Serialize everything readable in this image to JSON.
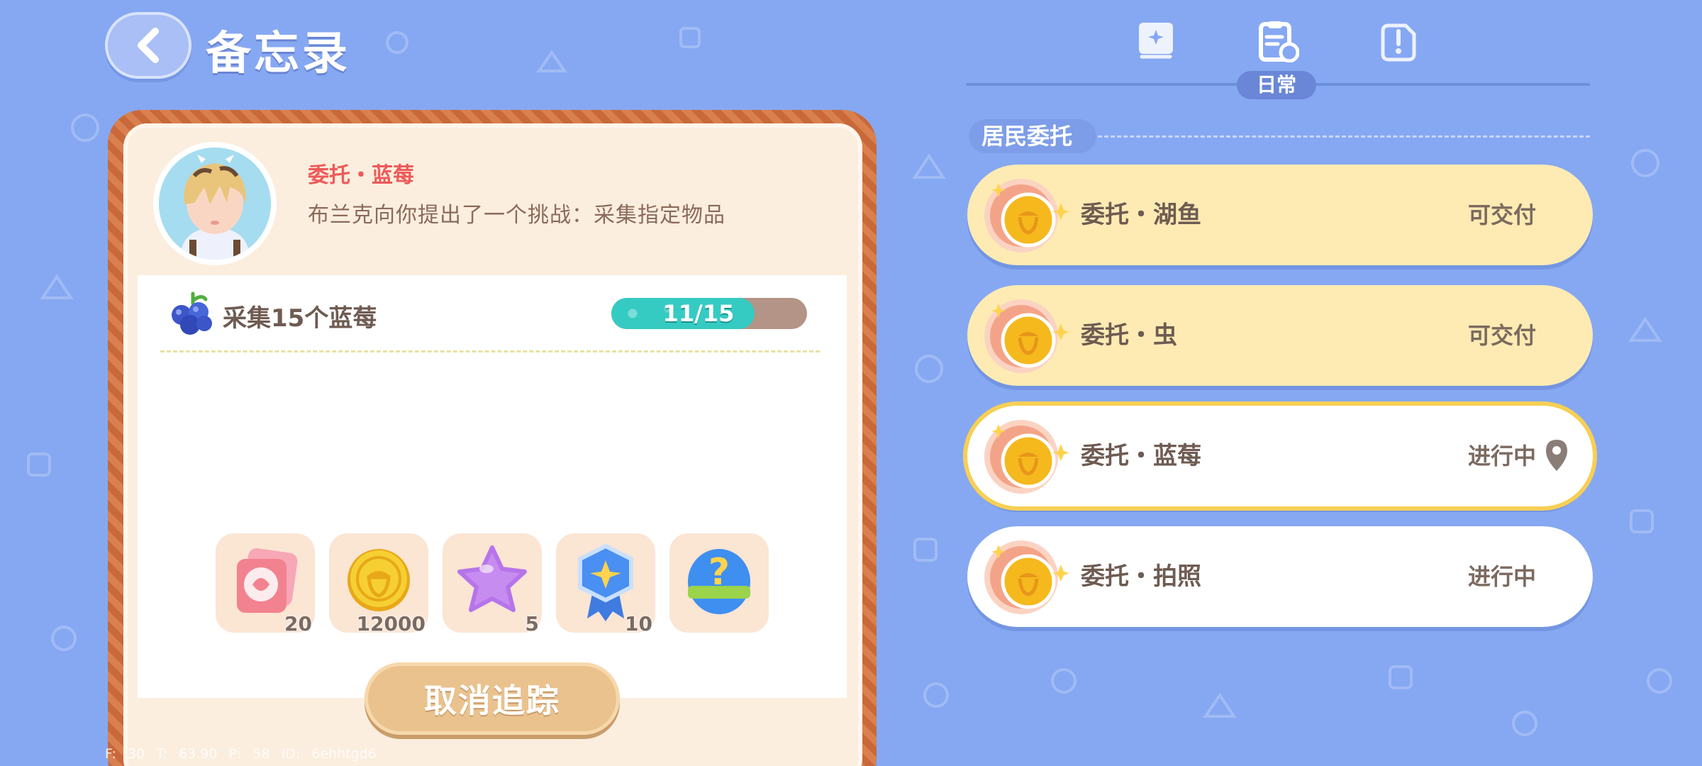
{
  "header": {
    "title": "备忘录",
    "back_icon": "chevron-left-icon"
  },
  "tabs": {
    "items": [
      {
        "icon": "book-icon",
        "label": ""
      },
      {
        "icon": "clipboard-refresh-icon",
        "label": "日常"
      },
      {
        "icon": "note-edit-icon",
        "label": ""
      }
    ],
    "active_label": "日常"
  },
  "detail": {
    "quest_title": "委托・蓝莓",
    "description": "布兰克向你提出了一个挑战：采集指定物品",
    "task": {
      "label": "采集15个蓝莓",
      "progress_text": "11/15",
      "progress_fraction": 0.733
    },
    "rewards": [
      {
        "icon": "ticket-icon",
        "count": "20"
      },
      {
        "icon": "acorn-coin-icon",
        "count": "12000"
      },
      {
        "icon": "star-icon",
        "count": "5"
      },
      {
        "icon": "badge-icon",
        "count": "10"
      },
      {
        "icon": "mystery-egg-icon",
        "count": ""
      }
    ],
    "cancel_button": "取消追踪"
  },
  "debug_text": "F: 30   T: 63.90   P: 58   ID: 6ehhtgd6",
  "right_panel": {
    "section_title": "居民委托",
    "quests": [
      {
        "name": "委托・湖鱼",
        "status": "可交付",
        "style": "yellow"
      },
      {
        "name": "委托・虫",
        "status": "可交付",
        "style": "yellow"
      },
      {
        "name": "委托・蓝莓",
        "status": "进行中",
        "style": "selected",
        "pin": true
      },
      {
        "name": "委托・拍照",
        "status": "进行中",
        "style": "white"
      }
    ]
  },
  "colors": {
    "background": "#86a8f2",
    "accent_red": "#ee5a5a",
    "progress_fill": "#35cbc3",
    "card_yellow": "#fdebb3",
    "selected_border": "#f7cf55"
  }
}
